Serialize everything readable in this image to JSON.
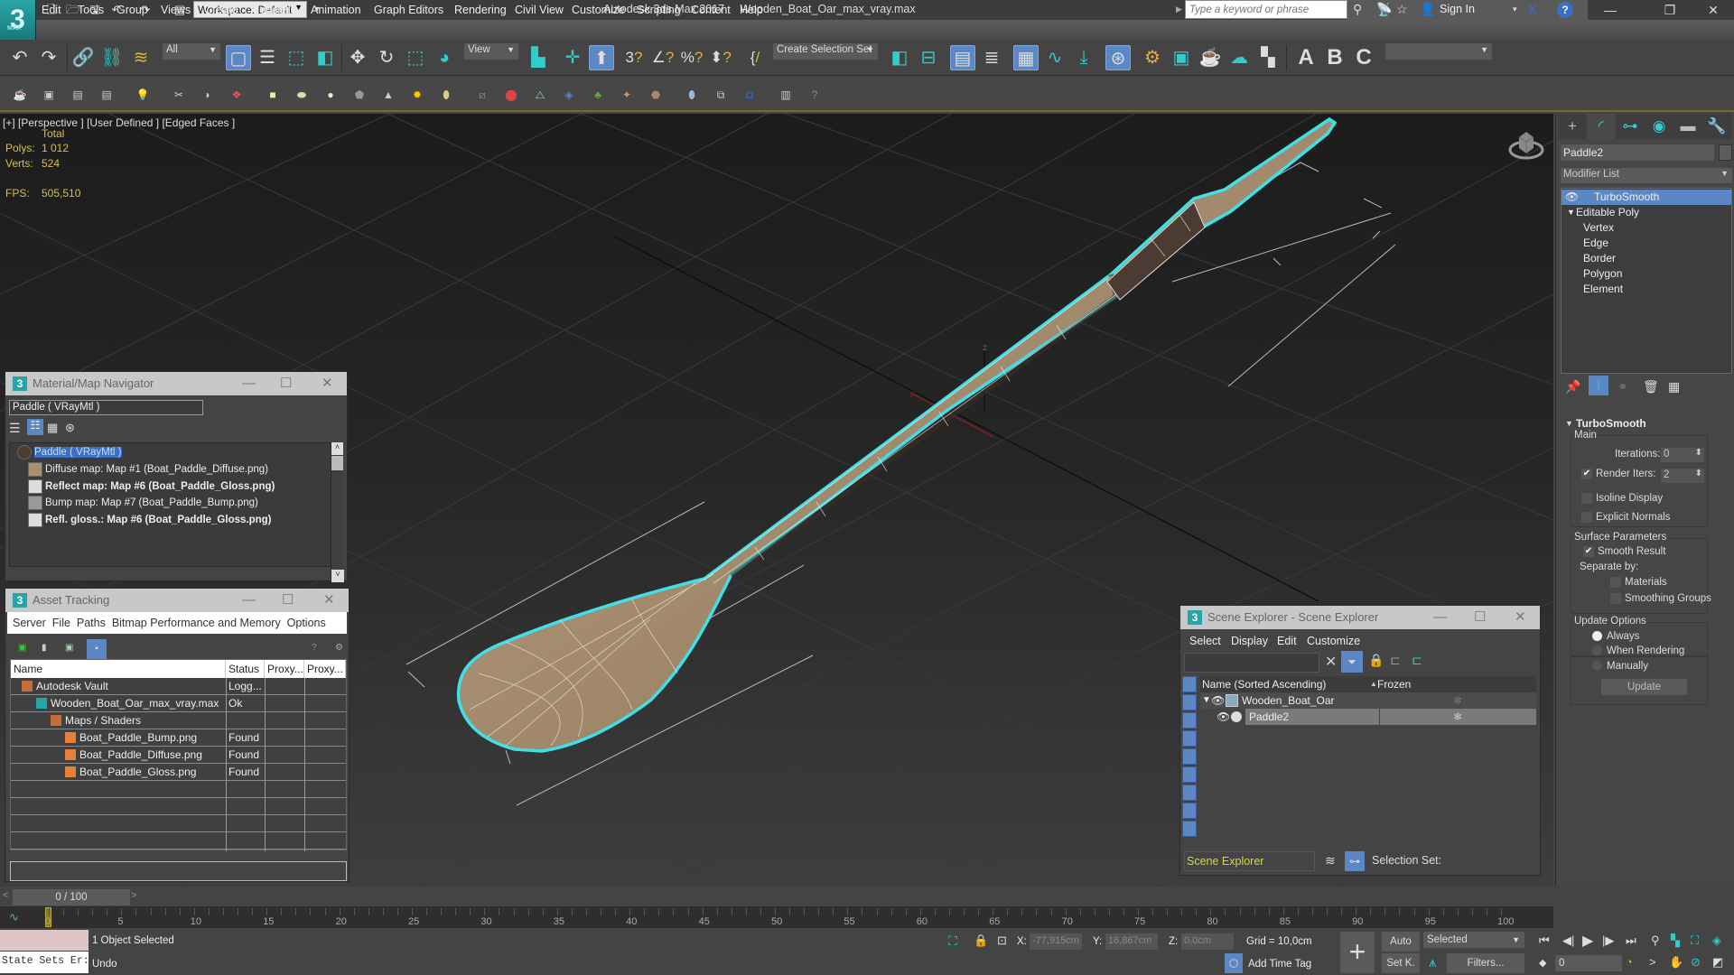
{
  "app": {
    "title": "Autodesk 3ds Max 2017",
    "file": "Wooden_Boat_Oar_max_vray.max",
    "logo_text": "3",
    "logo_sub": "MAX",
    "workspace": "Workspace: Default",
    "search_placeholder": "Type a keyword or phrase",
    "signin": "Sign In",
    "icons": [
      "new-file-icon",
      "open-file-icon",
      "save-icon",
      "undo-icon",
      "redo-icon",
      "project-icon"
    ],
    "window_controls": {
      "minimize": "—",
      "restore": "❐",
      "close": "✕"
    }
  },
  "menubar": [
    "Edit",
    "Tools",
    "Group",
    "Views",
    "Create",
    "Modifiers",
    "Animation",
    "Graph Editors",
    "Rendering",
    "Civil View",
    "Customize",
    "Scripting",
    "Content",
    "Help"
  ],
  "main_toolbar": {
    "selection_filter": "All",
    "reference_coord": "View",
    "named_selection": "Create Selection Set",
    "icons": [
      "undo-icon",
      "redo-icon",
      "link-icon",
      "unlink-icon",
      "bind-spacewarp-icon",
      "select-object-icon",
      "select-by-name-icon",
      "rect-region-icon",
      "window-crossing-icon",
      "move-icon",
      "rotate-icon",
      "scale-icon",
      "place-icon",
      "pivot-icon",
      "manipulate-icon",
      "keyboard-shortcut-icon",
      "snaps-icon",
      "angle-snap-icon",
      "percent-snap-icon",
      "spinner-snap-icon",
      "edit-named-sets-icon",
      "mirror-icon",
      "align-icon",
      "scene-explorer-icon",
      "layer-explorer-icon",
      "ribbon-icon",
      "curve-editor-icon",
      "dope-sheet-icon",
      "material-editor-icon",
      "render-setup-icon",
      "rendered-frame-window-icon",
      "render-icon",
      "render-cloud-icon",
      "render-iterative-icon",
      "a360-gallery-icon",
      "render-a-icon",
      "render-b-icon",
      "render-c-icon"
    ],
    "render_labels": [
      "A",
      "B",
      "C"
    ]
  },
  "viewport": {
    "label_parts": [
      "[+]",
      "[Perspective ]",
      "[User Defined ]",
      "[Edged Faces ]"
    ],
    "stats": {
      "header": "Total",
      "polys_label": "Polys:",
      "polys": "1 012",
      "verts_label": "Verts:",
      "verts": "524",
      "fps_label": "FPS:",
      "fps": "505,510"
    },
    "axis_labels": {
      "x": "x",
      "y": "y",
      "z": "z"
    }
  },
  "material_navigator": {
    "title": "Material/Map Navigator",
    "field": "Paddle  ( VRayMtl )",
    "tree": [
      {
        "label": "Paddle  ( VRayMtl )",
        "bold": false,
        "selected": true
      },
      {
        "label": "Diffuse map: Map #1 (Boat_Paddle_Diffuse.png)",
        "bold": false
      },
      {
        "label": "Reflect map: Map #6 (Boat_Paddle_Gloss.png)",
        "bold": true
      },
      {
        "label": "Bump map: Map #7 (Boat_Paddle_Bump.png)",
        "bold": false
      },
      {
        "label": "Refl. gloss.: Map #6 (Boat_Paddle_Gloss.png)",
        "bold": true
      }
    ]
  },
  "asset_tracking": {
    "title": "Asset Tracking",
    "menu": [
      "Server",
      "File",
      "Paths",
      "Bitmap Performance and Memory",
      "Options"
    ],
    "columns": [
      "Name",
      "Status",
      "Proxy...",
      "Proxy..."
    ],
    "rows": [
      {
        "name": "Autodesk Vault",
        "status": "Logg...",
        "indent": 0
      },
      {
        "name": "Wooden_Boat_Oar_max_vray.max",
        "status": "Ok",
        "indent": 1
      },
      {
        "name": "Maps / Shaders",
        "status": "",
        "indent": 2
      },
      {
        "name": "Boat_Paddle_Bump.png",
        "status": "Found",
        "indent": 3
      },
      {
        "name": "Boat_Paddle_Diffuse.png",
        "status": "Found",
        "indent": 3
      },
      {
        "name": "Boat_Paddle_Gloss.png",
        "status": "Found",
        "indent": 3
      }
    ]
  },
  "scene_explorer": {
    "title": "Scene Explorer - Scene Explorer",
    "menu": [
      "Select",
      "Display",
      "Edit",
      "Customize"
    ],
    "columns": [
      "Name (Sorted Ascending)",
      "Frozen"
    ],
    "rows": [
      {
        "name": "Wooden_Boat_Oar",
        "selected": false
      },
      {
        "name": "Paddle2",
        "selected": true
      }
    ],
    "explorer_name": "Scene Explorer",
    "selection_set_label": "Selection Set:"
  },
  "command_panel": {
    "object_name": "Paddle2",
    "modifier_list": "Modifier List",
    "stack": [
      "TurboSmooth",
      "Editable Poly",
      "Vertex",
      "Edge",
      "Border",
      "Polygon",
      "Element"
    ],
    "rollout_title": "TurboSmooth",
    "main_group": "Main",
    "iterations_label": "Iterations:",
    "iterations": "0",
    "render_iters_label": "Render Iters:",
    "render_iters": "2",
    "render_iters_checked": true,
    "isoline_label": "Isoline Display",
    "explicit_normals_label": "Explicit Normals",
    "surface_group": "Surface Parameters",
    "smooth_result_label": "Smooth Result",
    "separate_by_label": "Separate by:",
    "materials_label": "Materials",
    "smoothing_groups_label": "Smoothing Groups",
    "update_group": "Update Options",
    "update_options": [
      "Always",
      "When Rendering",
      "Manually"
    ],
    "update_selected": "Always",
    "update_button": "Update"
  },
  "timeline": {
    "frame_display": "0 / 100",
    "prev": "<",
    "next": ">",
    "current_frame": 0,
    "ticks": [
      "0",
      "5",
      "10",
      "15",
      "20",
      "25",
      "30",
      "35",
      "40",
      "45",
      "50",
      "55",
      "60",
      "65",
      "70",
      "75",
      "80",
      "85",
      "90",
      "95",
      "100"
    ]
  },
  "status_bar": {
    "maxscript_text": "State Sets Er:",
    "selection_status": "1 Object Selected",
    "prompt": "Undo",
    "x_label": "X:",
    "x": "-77,915cm",
    "y_label": "Y:",
    "y": "16,867cm",
    "z_label": "Z:",
    "z": "0,0cm",
    "grid": "Grid = 10,0cm",
    "add_time_tag": "Add Time Tag",
    "auto_key": "Auto",
    "set_key": "Set K.",
    "key_filter_select": "Selected",
    "filters": "Filters...",
    "frame_field": "0"
  }
}
